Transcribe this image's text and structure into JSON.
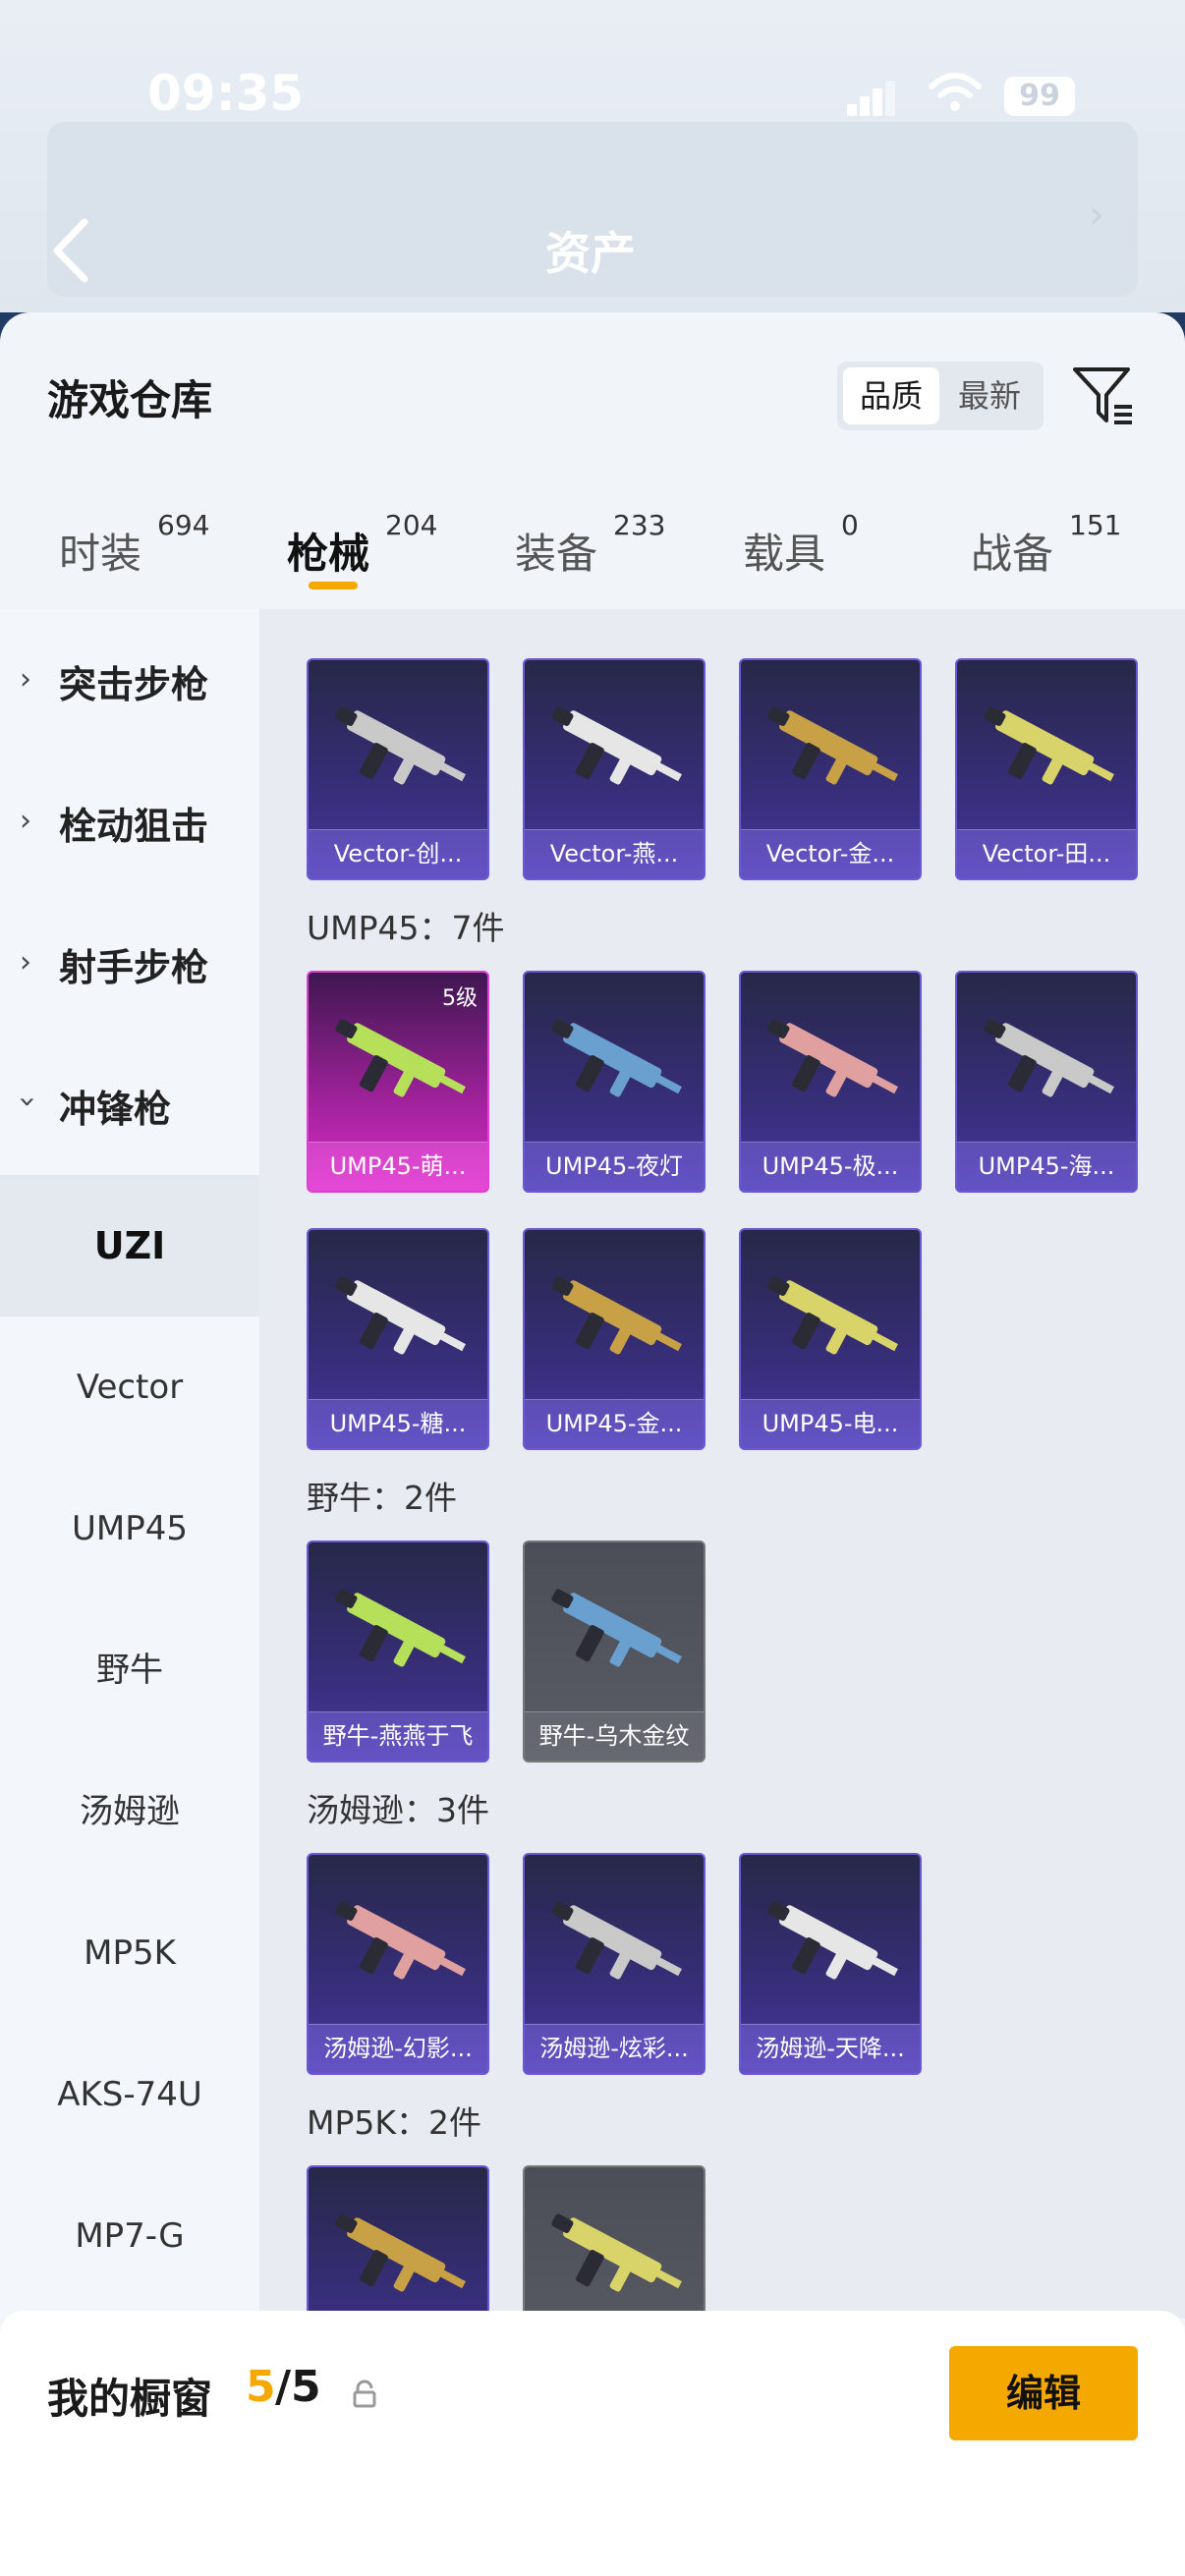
{
  "status_bar": {
    "time": "09:35",
    "battery": "99"
  },
  "header": {
    "title": "资产"
  },
  "warehouse": {
    "title": "游戏仓库",
    "sort_quality": "品质",
    "sort_latest": "最新"
  },
  "tabs": [
    {
      "label": "时装",
      "count": "694"
    },
    {
      "label": "枪械",
      "count": "204"
    },
    {
      "label": "装备",
      "count": "233"
    },
    {
      "label": "载具",
      "count": "0"
    },
    {
      "label": "战备",
      "count": "151"
    }
  ],
  "sidebar": {
    "categories": [
      "突击步枪",
      "栓动狙击",
      "射手步枪",
      "冲锋枪"
    ],
    "subitems": [
      "UZI",
      "Vector",
      "UMP45",
      "野牛",
      "汤姆逊",
      "MP5K",
      "AKS-74U",
      "MP7-G"
    ]
  },
  "sections": {
    "vector": {
      "items": [
        "Vector-创...",
        "Vector-燕...",
        "Vector-金...",
        "Vector-田..."
      ]
    },
    "ump45": {
      "title": "UMP45：7件",
      "level": "5级",
      "items": [
        "UMP45-萌...",
        "UMP45-夜灯",
        "UMP45-极...",
        "UMP45-海...",
        "UMP45-糖...",
        "UMP45-金...",
        "UMP45-电..."
      ]
    },
    "bison": {
      "title": "野牛：2件",
      "items": [
        "野牛-燕燕于飞",
        "野牛-乌木金纹"
      ]
    },
    "thompson": {
      "title": "汤姆逊：3件",
      "items": [
        "汤姆逊-幻影...",
        "汤姆逊-炫彩...",
        "汤姆逊-天降..."
      ]
    },
    "mp5k": {
      "title": "MP5K：2件"
    }
  },
  "showcase": {
    "label": "我的橱窗",
    "current": "5",
    "separator": "/",
    "total": "5",
    "edit_label": "编辑"
  },
  "colors": {
    "accent": "#f5a800",
    "card_purple": "#3a2f82",
    "card_pink": "#d82fc8",
    "card_gray": "#5a5c66"
  }
}
